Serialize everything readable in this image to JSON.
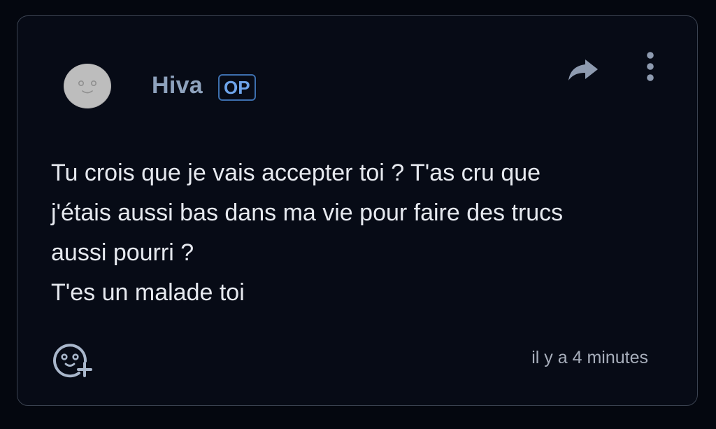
{
  "comment": {
    "author": "Hiva",
    "badge": "OP",
    "lines": [
      "Tu crois que je vais accepter toi ? T'as cru que",
      "j'étais aussi bas dans ma vie pour faire des trucs",
      "aussi pourri ?",
      "T'es un malade toi"
    ],
    "timestamp": "il y a 4 minutes"
  },
  "icons": {
    "avatar": "user-avatar",
    "share": "share-arrow-icon",
    "more": "more-vertical-icon",
    "reaction": "add-reaction-icon"
  },
  "colors": {
    "background": "#04070f",
    "card_border": "#3a4250",
    "username": "#8ea2bd",
    "badge_accent": "#6ea4ea",
    "body_text": "#e6e9ef",
    "timestamp": "#a7aebb"
  }
}
